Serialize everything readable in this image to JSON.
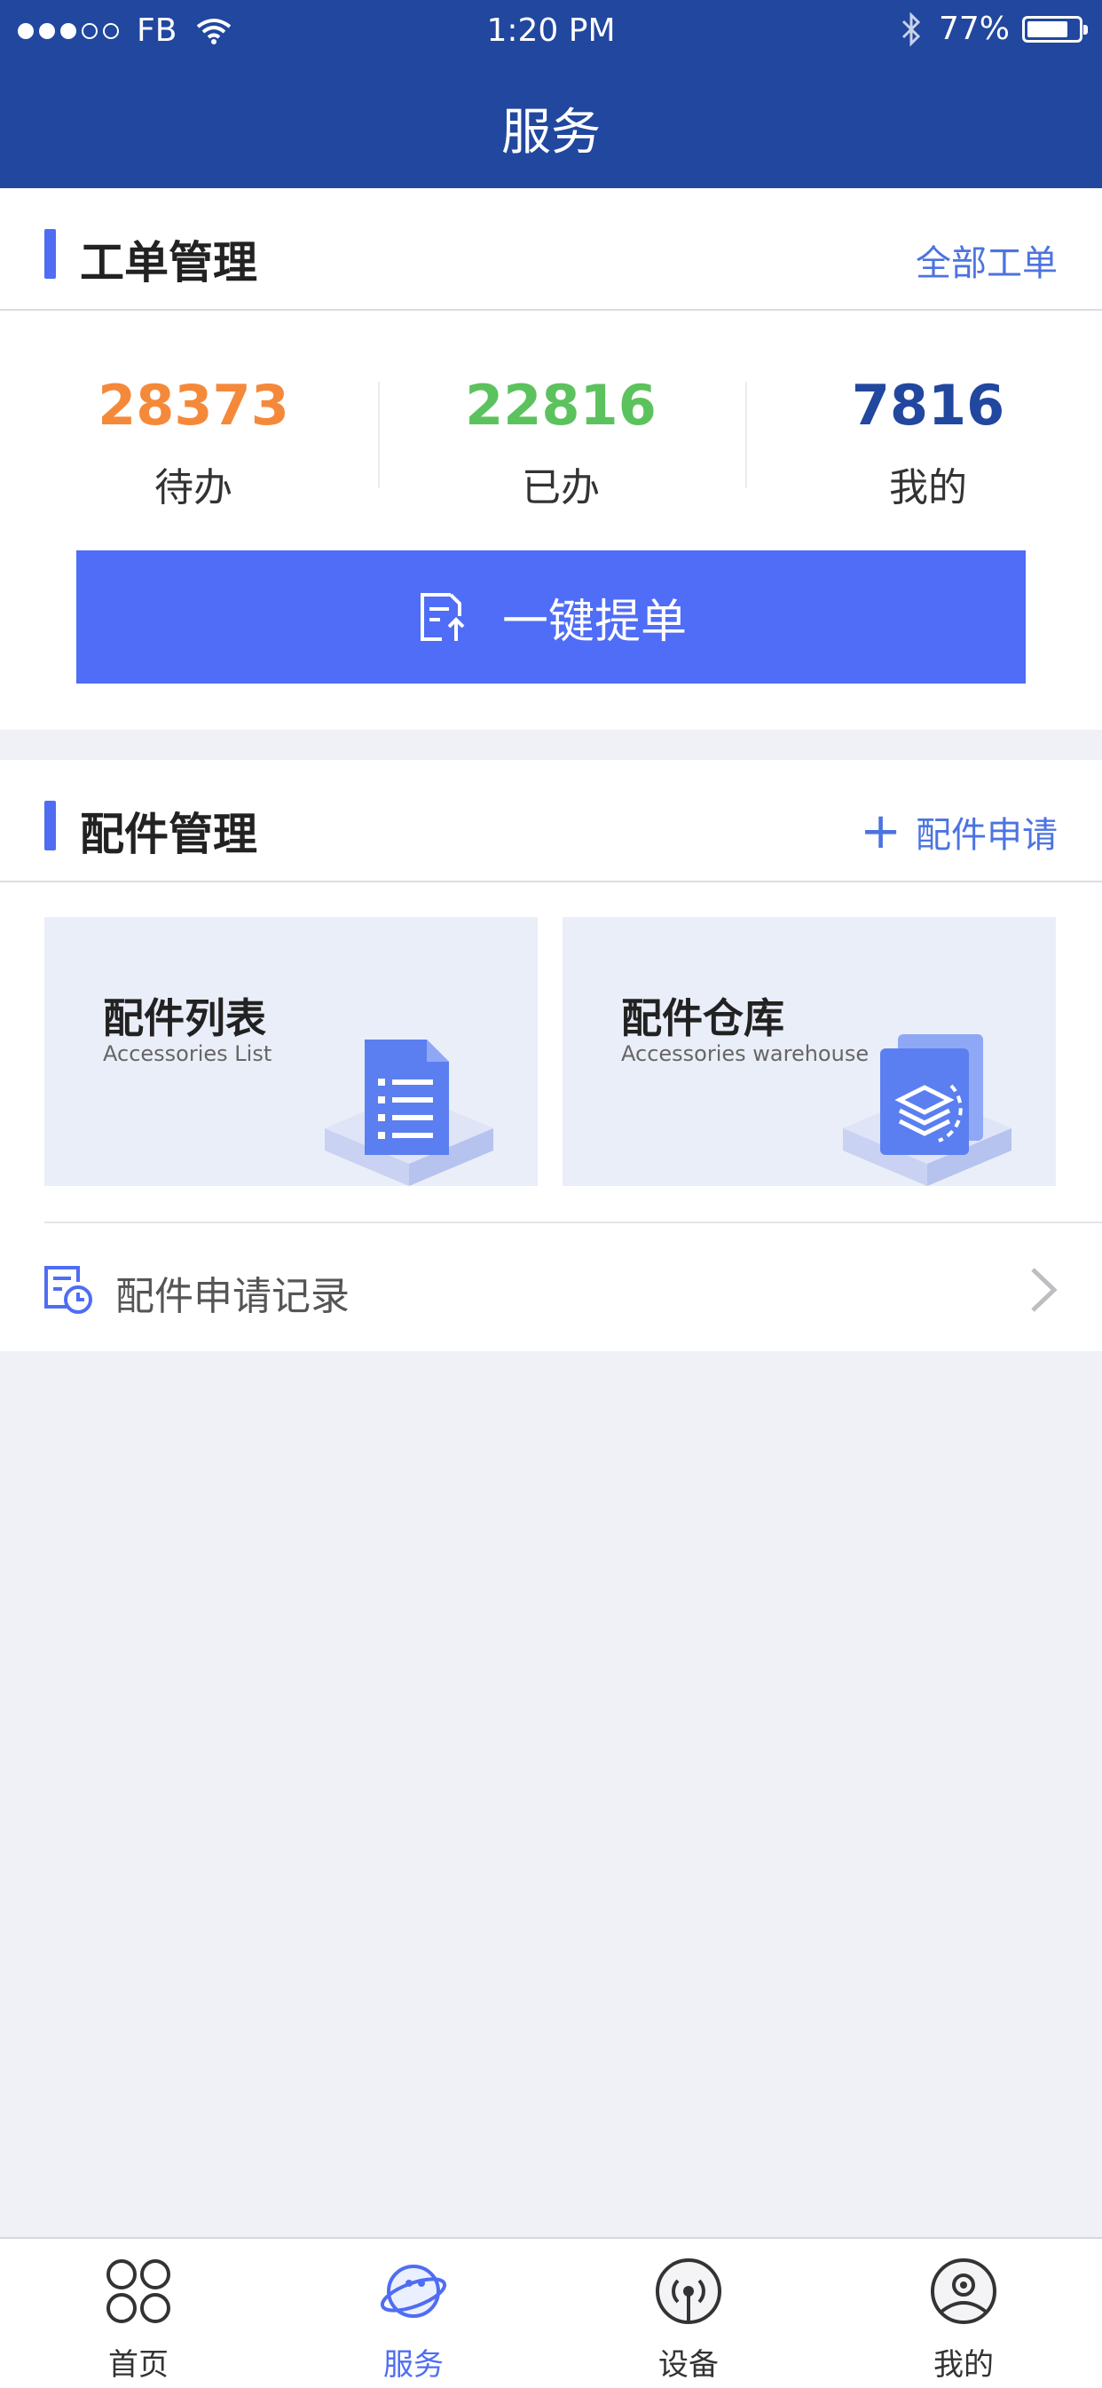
{
  "status_bar": {
    "carrier": "FB",
    "time": "1:20 PM",
    "battery": "77%",
    "battery_level": 0.77,
    "signal_bars": 3,
    "signal_total": 5
  },
  "header": {
    "title": "服务"
  },
  "work_orders": {
    "title": "工单管理",
    "link": "全部工单",
    "stats": [
      {
        "value": "28373",
        "label": "待办",
        "color": "#f5893a"
      },
      {
        "value": "22816",
        "label": "已办",
        "color": "#5cc25d"
      },
      {
        "value": "7816",
        "label": "我的",
        "color": "#21479f"
      }
    ],
    "button_label": "一键提单"
  },
  "parts": {
    "title": "配件管理",
    "link": "配件申请",
    "tiles": [
      {
        "title": "配件列表",
        "subtitle": "Accessories List",
        "icon": "document-list-icon"
      },
      {
        "title": "配件仓库",
        "subtitle": "Accessories warehouse",
        "icon": "warehouse-layers-icon"
      }
    ],
    "record_label": "配件申请记录"
  },
  "tabbar": {
    "items": [
      {
        "label": "首页",
        "icon": "home-grid-icon",
        "active": false
      },
      {
        "label": "服务",
        "icon": "service-planet-icon",
        "active": true
      },
      {
        "label": "设备",
        "icon": "device-signal-icon",
        "active": false
      },
      {
        "label": "我的",
        "icon": "profile-icon",
        "active": false
      }
    ]
  },
  "colors": {
    "header": "#21479f",
    "accent": "#4f6df3",
    "link": "#4c73e0",
    "background": "#f0f1f6"
  }
}
